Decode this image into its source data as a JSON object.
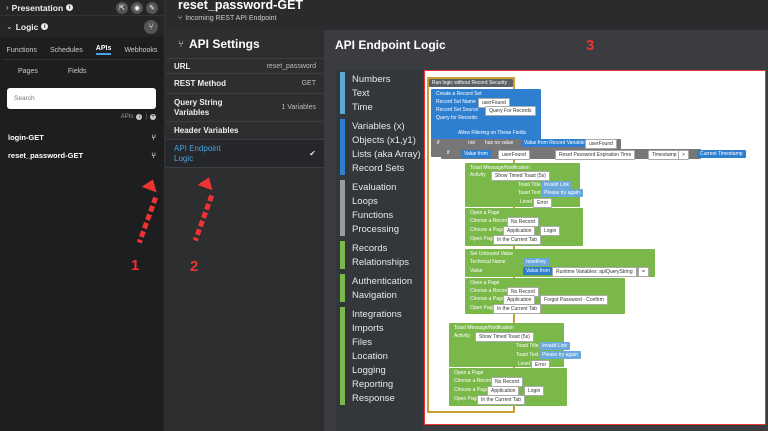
{
  "left": {
    "presentation_label": "Presentation",
    "logic_label": "Logic",
    "tabs": [
      "Functions",
      "Schedules",
      "APIs",
      "Webhooks"
    ],
    "subtabs": [
      "Pages",
      "Fields"
    ],
    "search_placeholder": "Search",
    "apis_label": "APIs",
    "api_items": [
      "login-GET",
      "reset_password-GET"
    ]
  },
  "header": {
    "title": "reset_password-GET",
    "subtitle": "Incoming REST API Endpoint"
  },
  "settings": {
    "title": "API Settings",
    "rows": [
      {
        "k": "URL",
        "v": "reset_password"
      },
      {
        "k": "REST Method",
        "v": "GET"
      },
      {
        "k": "Query String Variables",
        "v": "1 Variables"
      },
      {
        "k": "Header Variables",
        "v": ""
      },
      {
        "k": "API Endpoint Logic",
        "v": ""
      }
    ]
  },
  "logic": {
    "title": "API Endpoint Logic",
    "palette_groups": [
      {
        "color": "#5aa9d6",
        "items": [
          "Numbers",
          "Text",
          "Time"
        ]
      },
      {
        "color": "#2f7fd1",
        "items": [
          "Variables (x)",
          "Objects (x1,y1)",
          "Lists (aka Array)",
          "Record Sets"
        ]
      },
      {
        "color": "#9b9b9b",
        "items": [
          "Evaluation",
          "Loops",
          "Functions",
          "Processing"
        ]
      },
      {
        "color": "#7bb84a",
        "items": [
          "Records",
          "Relationships"
        ]
      },
      {
        "color": "#7bb84a",
        "items": [
          "Authentication",
          "Navigation"
        ]
      },
      {
        "color": "#7bb84a",
        "items": [
          "Integrations",
          "Imports",
          "Files",
          "Location",
          "Logging",
          "Reporting",
          "Response"
        ]
      }
    ]
  },
  "blocks": {
    "run_logic": "Run logic without Record Security",
    "create_record_set": "Create a Record Set",
    "record_set_name": "Record Set Name",
    "user_found": "userFound",
    "record_set_source": "Record Set Source",
    "query_for_records": "Query For Records",
    "query_for_records2": "Query for Records:",
    "allow_filtering": "Allow Filtering on These Fields",
    "if": "if",
    "not": "not",
    "has_no_value": "has no value",
    "value_from_record_variable": "Value from Record Variable",
    "value_from": "Value from",
    "reset_password_expiration_time": "Reset Password Expiration Time",
    "timestamp": "Timestamp",
    "current_timestamp": "Current Timestamp",
    "do": "do",
    "else": "else",
    "toast_message": "Toast Message/Notification",
    "activity": "Activity",
    "show_timed_toast": "Show Timed Toast (5s)",
    "toast_title": "Toast Title",
    "invalid_link": "Invalid Link",
    "toast_text": "Toast Text",
    "please_try_again": "Please try again",
    "level": "Level",
    "error": "Error",
    "open_a_page": "Open a Page",
    "choose_a_record": "Choose a Record",
    "no_record": "No Record",
    "choose_a_page": "Choose a Page",
    "application": "Application",
    "login": "Login",
    "open_page": "Open Page",
    "in_the_current_tab": "In the Current Tab",
    "set_unbound_value": "Set Unbound Value",
    "technical_name": "Technical Name",
    "reset_key": "resetKey",
    "value": "Value",
    "runtime_variables": "Runtime Variables: apiQueryString",
    "forgot_password_confirm": "Forgot Password - Confirm",
    "op_gt": ">",
    "op_eq": "="
  },
  "annotations": [
    "1",
    "2",
    "3"
  ],
  "colors": {
    "accent": "#f0c419",
    "link": "#4aa3df",
    "annotation": "#e33333"
  }
}
